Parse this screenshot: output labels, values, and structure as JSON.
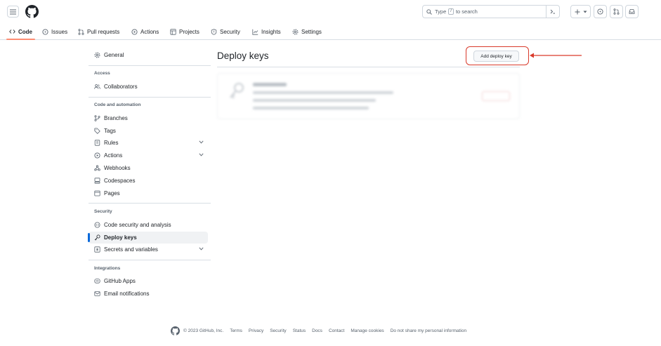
{
  "header": {
    "search_prefix": "Type",
    "search_key": "/",
    "search_suffix": "to search"
  },
  "repo_nav": {
    "tabs": [
      {
        "label": "Code",
        "icon": "code-icon"
      },
      {
        "label": "Issues",
        "icon": "issue-opened-icon"
      },
      {
        "label": "Pull requests",
        "icon": "git-pull-request-icon"
      },
      {
        "label": "Actions",
        "icon": "play-icon"
      },
      {
        "label": "Projects",
        "icon": "table-icon"
      },
      {
        "label": "Security",
        "icon": "shield-icon"
      },
      {
        "label": "Insights",
        "icon": "graph-icon"
      },
      {
        "label": "Settings",
        "icon": "gear-icon"
      }
    ]
  },
  "sidebar": {
    "general": "General",
    "access_heading": "Access",
    "collaborators": "Collaborators",
    "code_heading": "Code and automation",
    "branches": "Branches",
    "tags": "Tags",
    "rules": "Rules",
    "actions": "Actions",
    "webhooks": "Webhooks",
    "codespaces": "Codespaces",
    "pages": "Pages",
    "security_heading": "Security",
    "code_security": "Code security and analysis",
    "deploy_keys": "Deploy keys",
    "secrets": "Secrets and variables",
    "integrations_heading": "Integrations",
    "github_apps": "GitHub Apps",
    "email_notifications": "Email notifications"
  },
  "main": {
    "title": "Deploy keys",
    "add_button": "Add deploy key"
  },
  "footer": {
    "copyright": "© 2023 GitHub, Inc.",
    "links": [
      "Terms",
      "Privacy",
      "Security",
      "Status",
      "Docs",
      "Contact",
      "Manage cookies",
      "Do not share my personal information"
    ]
  },
  "colors": {
    "accent_blue": "#0969da",
    "tab_underline": "#fd8c73",
    "highlight_red": "#d93a2b"
  }
}
